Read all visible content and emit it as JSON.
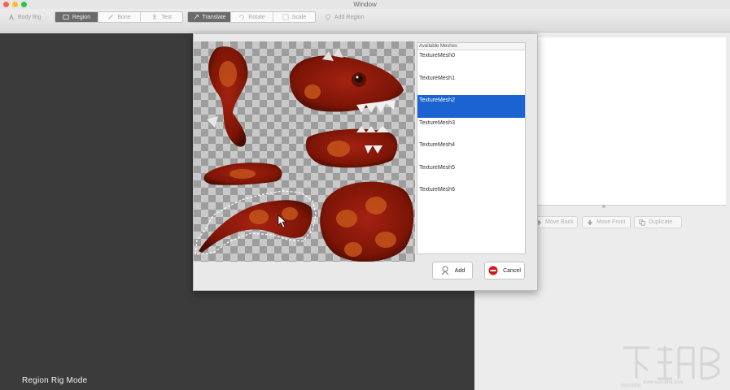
{
  "window": {
    "title": "Window"
  },
  "toolbar": {
    "body_rig": "Body Rig",
    "mode_tabs": [
      "Region",
      "Bone",
      "Test"
    ],
    "active_mode": "Region",
    "transform_tabs": [
      "Translate",
      "Rotate",
      "Scale"
    ],
    "active_transform": "Translate",
    "add_region": "Add Region"
  },
  "canvas": {
    "mode_label": "Region Rig Mode"
  },
  "right_panel": {
    "buttons": [
      "Move Back",
      "Move Front",
      "Duplicate"
    ]
  },
  "dialog": {
    "list_header": "Available Meshes",
    "meshes": [
      "TextureMesh0",
      "TextureMesh1",
      "TextureMesh2",
      "TextureMesh3",
      "TextureMesh4",
      "TextureMesh5",
      "TextureMesh6"
    ],
    "selected_mesh": "TextureMesh2",
    "add_label": "Add",
    "cancel_label": "Cancel"
  },
  "watermark": {
    "url": "www.xiazaiba.com"
  },
  "colors": {
    "selection": "#1a63d0",
    "texture_red": "#8a1a0a",
    "texture_orange": "#d45a14",
    "canvas_dark": "#3b3b3b"
  }
}
